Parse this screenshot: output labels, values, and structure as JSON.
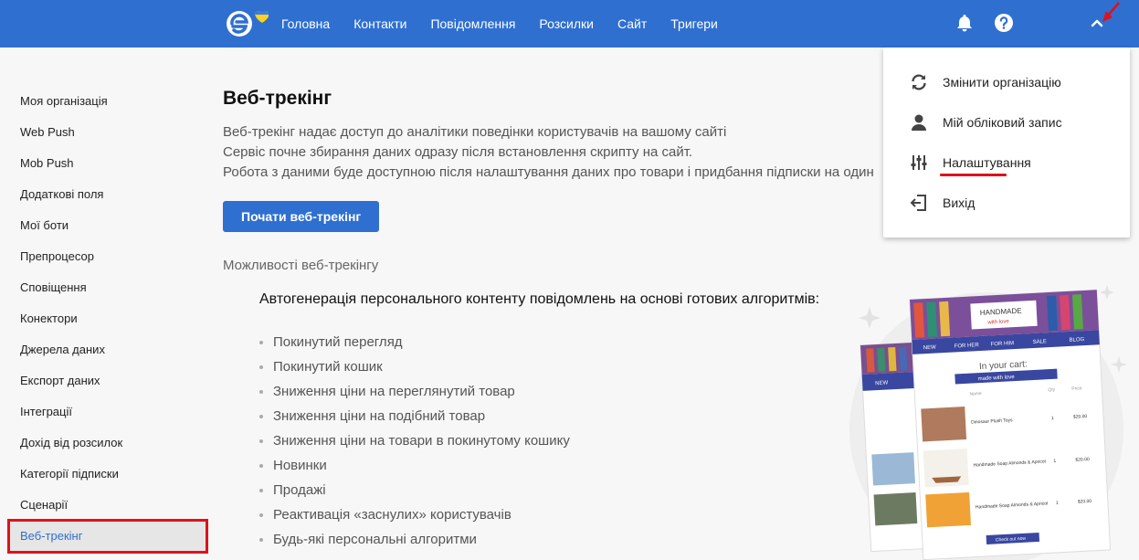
{
  "nav": {
    "items": [
      "Головна",
      "Контакти",
      "Повідомлення",
      "Розсилки",
      "Сайт",
      "Тригери"
    ]
  },
  "sidebar": {
    "items": [
      {
        "label": "Моя організація"
      },
      {
        "label": "Web Push"
      },
      {
        "label": "Mob Push"
      },
      {
        "label": "Додаткові поля"
      },
      {
        "label": "Мої боти"
      },
      {
        "label": "Препроцесор"
      },
      {
        "label": "Сповіщення"
      },
      {
        "label": "Конектори"
      },
      {
        "label": "Джерела даних"
      },
      {
        "label": "Експорт даних"
      },
      {
        "label": "Інтеграції"
      },
      {
        "label": "Дохід від розсилок"
      },
      {
        "label": "Категорії підписки"
      },
      {
        "label": "Сценарії"
      },
      {
        "label": "Веб-трекінг"
      }
    ],
    "active": "Веб-трекінг"
  },
  "main": {
    "title": "Веб-трекінг",
    "desc": [
      "Веб-трекінг надає доступ до аналітики поведінки користувачів на вашому сайті",
      "Сервіс почне збирання даних одразу після встановлення скрипту на сайт.",
      "Робота з даними буде доступною після налаштування даних про товари і придбання підписки на один"
    ],
    "cta": "Почати веб-трекінг",
    "subhead": "Можливості веб-трекінгу",
    "features_heading": "Автогенерація персонального контенту повідомлень на основі готових алгоритмів:",
    "features": [
      "Покинутий перегляд",
      "Покинутий кошик",
      "Зниження ціни на переглянутий товар",
      "Зниження ціни на подібний товар",
      "Зниження ціни на товари в покинутому кошику",
      "Новинки",
      "Продажі",
      "Реактивація «заснулих» користувачів",
      "Будь-які персональні алгоритми"
    ]
  },
  "dropdown": {
    "items": [
      {
        "label": "Змінити організацію",
        "icon": "sync-icon"
      },
      {
        "label": "Мій обліковий запис",
        "icon": "user-icon"
      },
      {
        "label": "Налаштування",
        "icon": "sliders-icon"
      },
      {
        "label": "Вихід",
        "icon": "logout-icon"
      }
    ]
  },
  "illustration": {
    "logo_text": "HANDMADE",
    "logo_sub": "with love",
    "menu": [
      "NEW",
      "FOR HER",
      "FOR HIM",
      "SALE",
      "BLOG"
    ],
    "cart_title": "In your cart:",
    "cart_sub": "made with love",
    "col_name": "Name",
    "col_qty": "Qty",
    "col_price": "Price",
    "rows": [
      {
        "name": "Dinosaur Plush Toys",
        "qty": "1",
        "price": "$20.00"
      },
      {
        "name": "Handmade Soap Almonds & Apricot",
        "qty": "1",
        "price": "$20.00"
      },
      {
        "name": "Handmade Soap Almonds & Apricot",
        "qty": "1",
        "price": "$20.00"
      }
    ],
    "checkout": "Check out now"
  },
  "colors": {
    "header": "#2f6fd0",
    "accent": "#2f6fd0",
    "highlight": "#e0111b"
  }
}
